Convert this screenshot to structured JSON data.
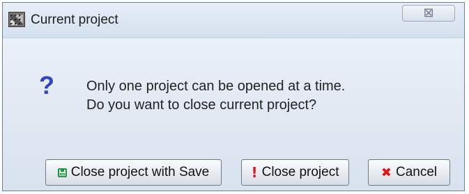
{
  "window": {
    "title": "Current project",
    "app_icon": "project-app-icon",
    "close_glyph": "⊠"
  },
  "message": {
    "icon": "question-icon",
    "icon_glyph": "?",
    "line1": "Only one project can be opened at a time.",
    "line2": "Do you want to close current project?"
  },
  "buttons": {
    "save": {
      "label": "Close project with Save",
      "icon": "floppy-disk-icon"
    },
    "close": {
      "label": "Close project",
      "icon": "exclamation-icon",
      "glyph": "!"
    },
    "cancel": {
      "label": "Cancel",
      "icon": "x-icon",
      "glyph": "✖"
    }
  },
  "colors": {
    "question": "#2f47c6",
    "save_icon": "#1d9a3a",
    "warn_icon": "#e0191c",
    "cancel_icon": "#d9171a"
  }
}
